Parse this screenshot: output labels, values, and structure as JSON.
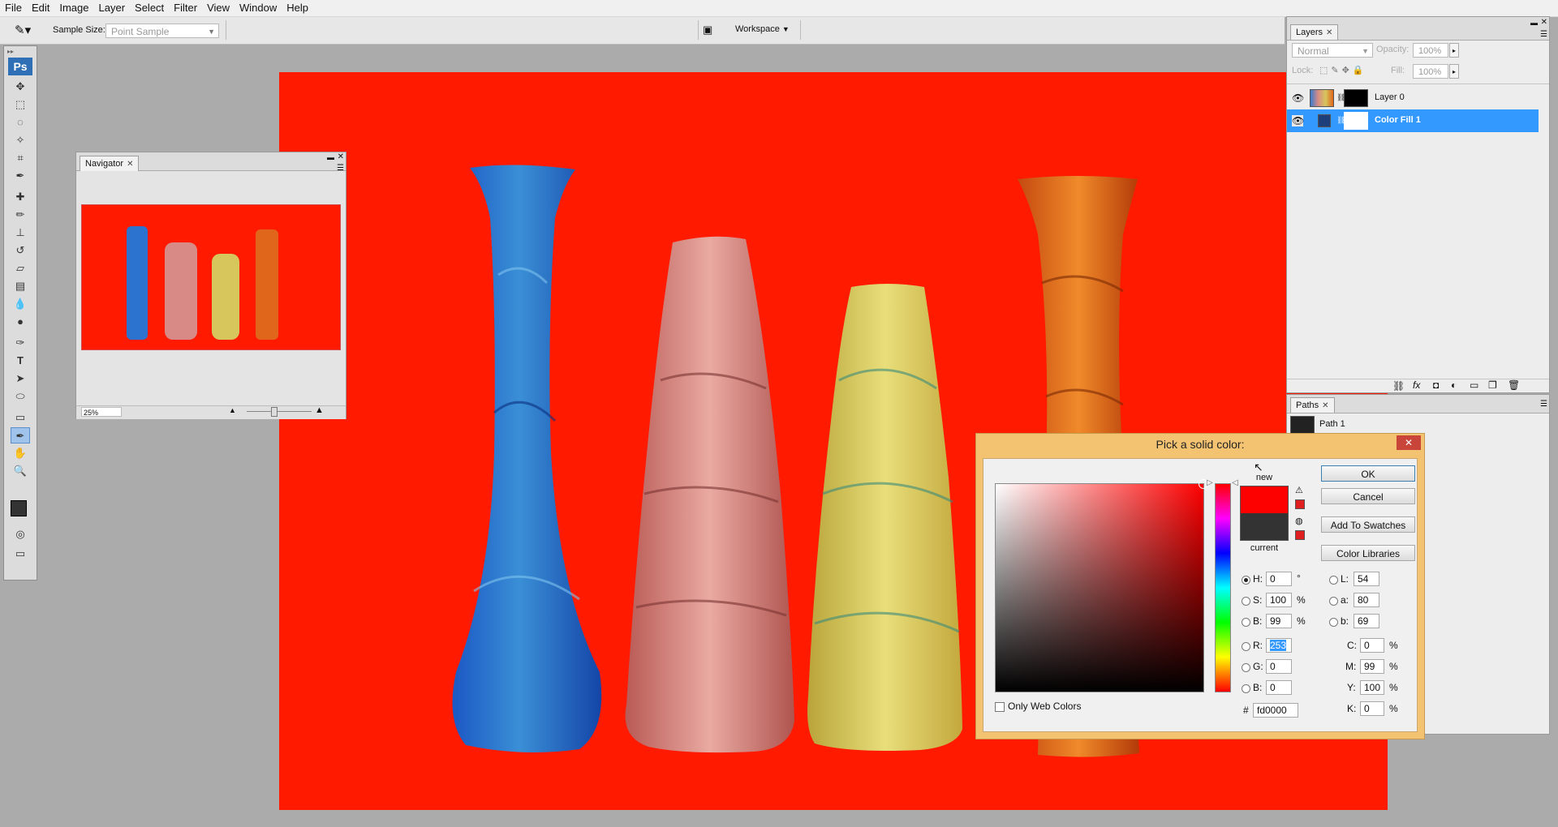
{
  "menu": [
    "File",
    "Edit",
    "Image",
    "Layer",
    "Select",
    "Filter",
    "View",
    "Window",
    "Help"
  ],
  "options": {
    "sample_size_label": "Sample Size:",
    "sample_size_value": "Point Sample",
    "workspace_label": "Workspace"
  },
  "toolbox": {
    "logo": "Ps"
  },
  "navigator": {
    "tab": "Navigator",
    "zoom": "25%"
  },
  "layers": {
    "tab": "Layers",
    "blend_mode": "Normal",
    "opacity_label": "Opacity:",
    "opacity_value": "100%",
    "lock_label": "Lock:",
    "fill_label": "Fill:",
    "fill_value": "100%",
    "items": [
      {
        "name": "Layer 0",
        "selected": false
      },
      {
        "name": "Color Fill 1",
        "selected": true
      }
    ]
  },
  "paths": {
    "tab": "Paths",
    "items": [
      {
        "name": "Path 1"
      }
    ]
  },
  "dialog": {
    "title": "Pick a solid color:",
    "new_label": "new",
    "current_label": "current",
    "new_color": "#fd0000",
    "current_color": "#333333",
    "buttons": {
      "ok": "OK",
      "cancel": "Cancel",
      "add_swatches": "Add To Swatches",
      "libraries": "Color Libraries"
    },
    "hsb": {
      "h_label": "H:",
      "h": "0",
      "h_unit": "°",
      "s_label": "S:",
      "s": "100",
      "s_unit": "%",
      "b_label": "B:",
      "b": "99",
      "b_unit": "%"
    },
    "rgb": {
      "r_label": "R:",
      "r": "253",
      "g_label": "G:",
      "g": "0",
      "b_label": "B:",
      "b": "0"
    },
    "lab": {
      "l_label": "L:",
      "l": "54",
      "a_label": "a:",
      "a": "80",
      "b_label": "b:",
      "b": "69"
    },
    "cmyk": {
      "c_label": "C:",
      "c": "0",
      "m_label": "M:",
      "m": "99",
      "y_label": "Y:",
      "y": "100",
      "k_label": "K:",
      "k": "0",
      "unit": "%"
    },
    "hex_label": "#",
    "hex": "fd0000",
    "only_web_colors": "Only Web Colors",
    "close_glyph": "✕"
  },
  "colors": {
    "canvas_bg": "#ff1a00",
    "selection": "#3399ff",
    "dialog_frame": "#f3c372"
  }
}
